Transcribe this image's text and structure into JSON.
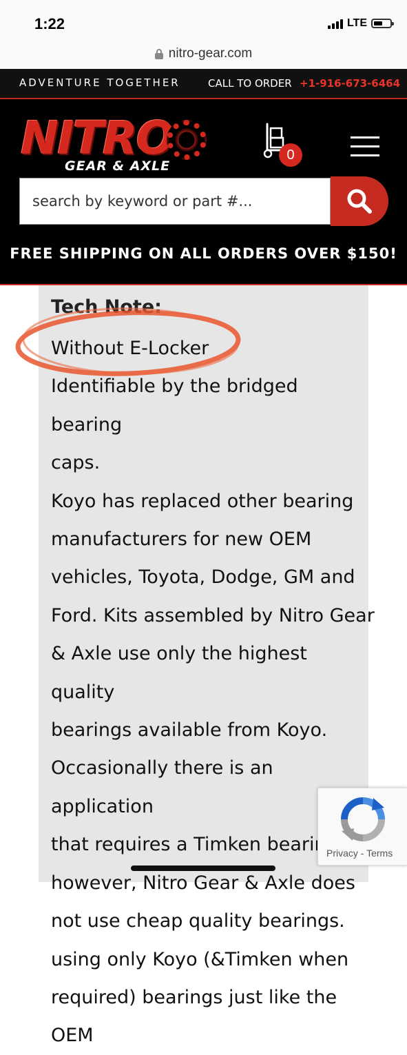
{
  "status_bar": {
    "time": "1:22",
    "network": "LTE"
  },
  "browser": {
    "url": "nitro-gear.com"
  },
  "topline": {
    "tagline": "ADVENTURE TOGETHER",
    "call_label": "CALL TO ORDER",
    "phone": "+1-916-673-6464"
  },
  "header": {
    "logo_main": "NITRO",
    "logo_sub": "GEAR & AXLE",
    "cart_count": "0",
    "search_placeholder": "search by keyword or part #...",
    "promo": "FREE SHIPPING ON ALL ORDERS OVER $150!"
  },
  "content": {
    "tech_note_label": "Tech Note:",
    "lines": [
      "Without E-Locker",
      "Identifiable by the bridged bearing",
      "caps.",
      "Koyo has replaced other bearing",
      "manufacturers for new OEM",
      "vehicles, Toyota, Dodge, GM and",
      "Ford. Kits assembled by Nitro Gear",
      "& Axle use only the highest quality",
      "bearings available from Koyo.",
      "Occasionally there is an application",
      "that requires a Timken bearing;",
      "however, Nitro Gear & Axle does",
      "not use cheap quality bearings.",
      "using only Koyo (&Timken when",
      "required) bearings just like the OEM"
    ]
  },
  "recaptcha": {
    "privacy": "Privacy",
    "separator": " - ",
    "terms": "Terms"
  },
  "colors": {
    "brand_red": "#c62b22",
    "header_bg": "#000000",
    "panel_bg": "#e6e6e6",
    "annotation": "#e8552e"
  }
}
